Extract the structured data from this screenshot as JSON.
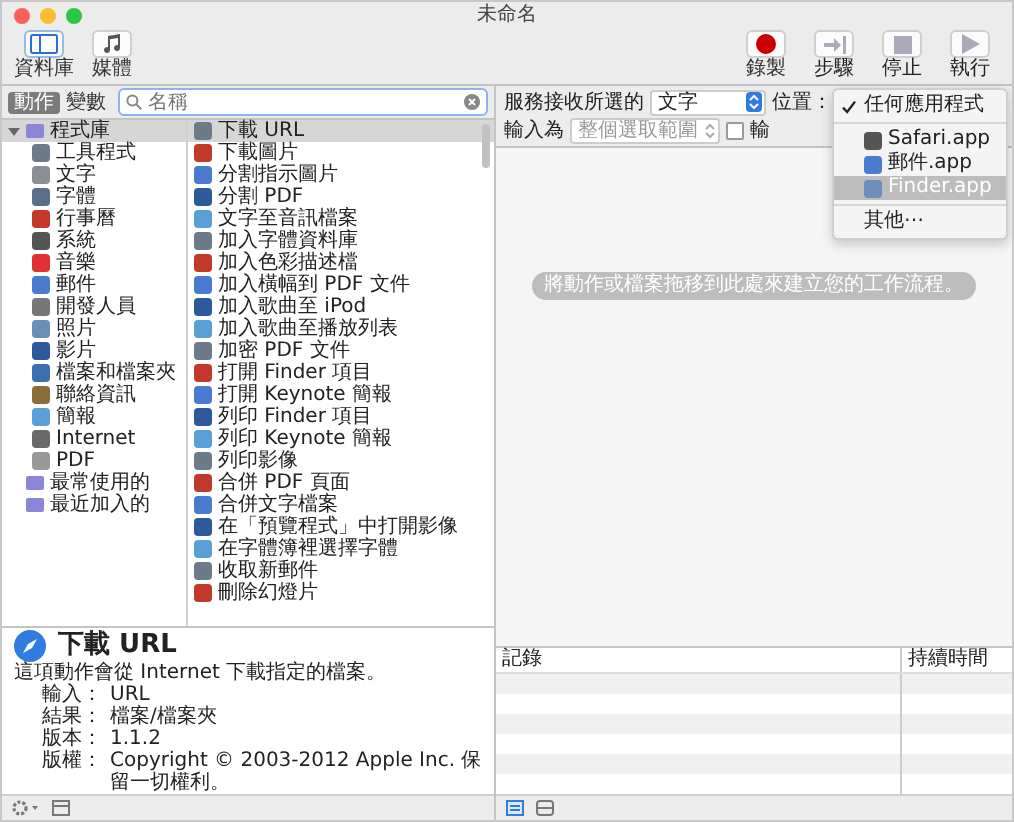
{
  "window": {
    "title": "未命名"
  },
  "toolbar": {
    "left": [
      {
        "label": "資料庫",
        "kind": "library",
        "selected": true
      },
      {
        "label": "媒體",
        "kind": "media",
        "selected": false
      }
    ],
    "right": [
      {
        "label": "錄製",
        "kind": "record",
        "disabled": false
      },
      {
        "label": "步驟",
        "kind": "step",
        "disabled": true
      },
      {
        "label": "停止",
        "kind": "stop",
        "disabled": true
      },
      {
        "label": "執行",
        "kind": "run",
        "disabled": true
      }
    ]
  },
  "library": {
    "tabs": [
      {
        "label": "動作",
        "selected": true
      },
      {
        "label": "變數",
        "selected": false
      }
    ],
    "search": {
      "placeholder": "名稱"
    },
    "tree": [
      {
        "label": "程式庫",
        "expanded": true,
        "selected": true,
        "children": [
          {
            "label": "工具程式",
            "selected": false
          },
          {
            "label": "文字",
            "selected": false
          },
          {
            "label": "字體",
            "selected": false
          },
          {
            "label": "行事曆",
            "selected": false
          },
          {
            "label": "系統",
            "selected": false
          },
          {
            "label": "音樂",
            "selected": false
          },
          {
            "label": "郵件",
            "selected": false
          },
          {
            "label": "開發人員",
            "selected": false
          },
          {
            "label": "照片",
            "selected": false
          },
          {
            "label": "影片",
            "selected": false
          },
          {
            "label": "檔案和檔案夾",
            "selected": false
          },
          {
            "label": "聯絡資訊",
            "selected": false
          },
          {
            "label": "簡報",
            "selected": false
          },
          {
            "label": "Internet",
            "selected": false
          },
          {
            "label": "PDF",
            "selected": false
          }
        ]
      },
      {
        "label": "最常使用的",
        "selected": false
      },
      {
        "label": "最近加入的",
        "selected": false
      }
    ]
  },
  "actions": [
    {
      "label": "下載 URL",
      "selected": true
    },
    {
      "label": "下載圖片",
      "selected": false
    },
    {
      "label": "分割指示圖片",
      "selected": false
    },
    {
      "label": "分割 PDF",
      "selected": false
    },
    {
      "label": "文字至音訊檔案",
      "selected": false
    },
    {
      "label": "加入字體資料庫",
      "selected": false
    },
    {
      "label": "加入色彩描述檔",
      "selected": false
    },
    {
      "label": "加入橫幅到 PDF 文件",
      "selected": false
    },
    {
      "label": "加入歌曲至 iPod",
      "selected": false
    },
    {
      "label": "加入歌曲至播放列表",
      "selected": false
    },
    {
      "label": "加密 PDF 文件",
      "selected": false
    },
    {
      "label": "打開 Finder 項目",
      "selected": false
    },
    {
      "label": "打開 Keynote 簡報",
      "selected": false
    },
    {
      "label": "列印 Finder 項目",
      "selected": false
    },
    {
      "label": "列印 Keynote 簡報",
      "selected": false
    },
    {
      "label": "列印影像",
      "selected": false
    },
    {
      "label": "合併 PDF 頁面",
      "selected": false
    },
    {
      "label": "合併文字檔案",
      "selected": false
    },
    {
      "label": "在「預覽程式」中打開影像",
      "selected": false
    },
    {
      "label": "在字體簿裡選擇字體",
      "selected": false
    },
    {
      "label": "收取新郵件",
      "selected": false
    },
    {
      "label": "刪除幻燈片",
      "selected": false
    }
  ],
  "description": {
    "title": "下載 URL",
    "text": "這項動作會從 Internet 下載指定的檔案。",
    "fields": [
      {
        "label": "輸入：",
        "value": "URL"
      },
      {
        "label": "結果：",
        "value": "檔案/檔案夾"
      },
      {
        "label": "版本：",
        "value": "1.1.2"
      },
      {
        "label": "版權：",
        "value": "Copyright © 2003-2012 Apple Inc. 保留一切權利。"
      }
    ]
  },
  "workflow": {
    "receives_label": "服務接收所選的",
    "receives_value": "文字",
    "location_label": "位置：",
    "input_label": "輸入為",
    "input_value": "整個選取範圍",
    "output_checkbox": {
      "label": "輸",
      "checked": false
    },
    "location_menu": [
      {
        "kind": "option",
        "label": "任何應用程式",
        "checked": true,
        "selected": false
      },
      {
        "kind": "separator"
      },
      {
        "kind": "app",
        "label": "Safari.app",
        "checked": false,
        "selected": false
      },
      {
        "kind": "app",
        "label": "郵件.app",
        "checked": false,
        "selected": false
      },
      {
        "kind": "app",
        "label": "Finder.app",
        "checked": false,
        "selected": true
      },
      {
        "kind": "separator"
      },
      {
        "kind": "option",
        "label": "其他⋯",
        "checked": false,
        "selected": false
      }
    ],
    "hint": "將動作或檔案拖移到此處來建立您的工作流程。"
  },
  "log": {
    "columns": [
      "記錄",
      "持續時間"
    ]
  }
}
